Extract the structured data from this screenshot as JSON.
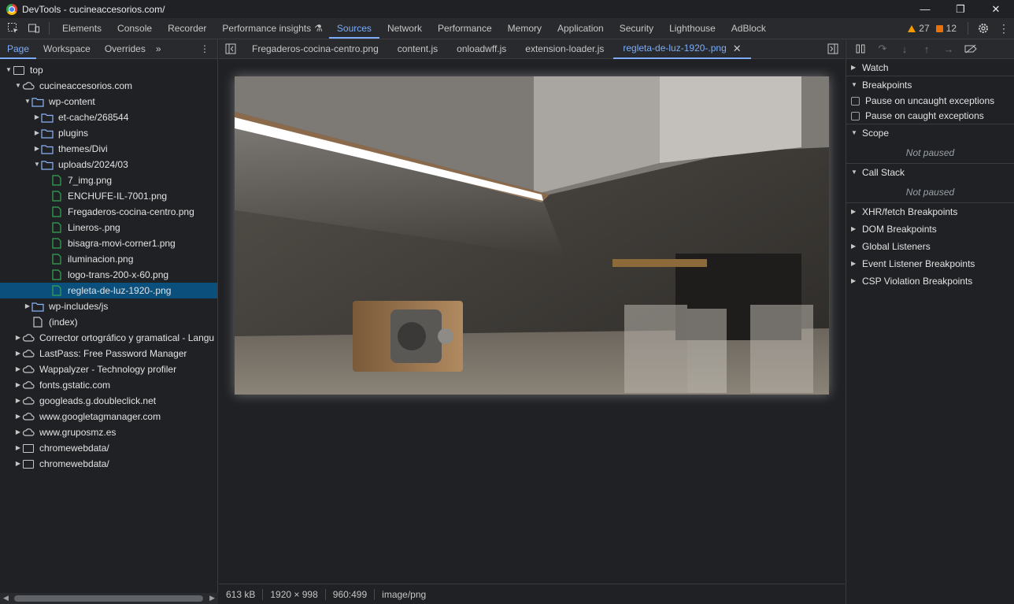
{
  "window": {
    "title": "DevTools - cucineaccesorios.com/",
    "controls": {
      "minimize": "—",
      "restore": "❐",
      "close": "✕"
    }
  },
  "toolbar": {
    "tabs": [
      "Elements",
      "Console",
      "Recorder",
      "Performance insights",
      "Sources",
      "Network",
      "Performance",
      "Memory",
      "Application",
      "Security",
      "Lighthouse",
      "AdBlock"
    ],
    "active_tab": "Sources",
    "warnings_count": "27",
    "errors_count": "12"
  },
  "navigator": {
    "tabs": [
      "Page",
      "Workspace",
      "Overrides"
    ],
    "more": "»",
    "tree": [
      {
        "label": "top",
        "depth": 0,
        "icon": "frame-icon",
        "expanded": true
      },
      {
        "label": "cucineaccesorios.com",
        "depth": 1,
        "icon": "cloud-icon",
        "expanded": true
      },
      {
        "label": "wp-content",
        "depth": 2,
        "icon": "folder-icon",
        "expanded": true
      },
      {
        "label": "et-cache/268544",
        "depth": 3,
        "icon": "folder-icon",
        "expanded": false
      },
      {
        "label": "plugins",
        "depth": 3,
        "icon": "folder-icon",
        "expanded": false
      },
      {
        "label": "themes/Divi",
        "depth": 3,
        "icon": "folder-icon",
        "expanded": false
      },
      {
        "label": "uploads/2024/03",
        "depth": 3,
        "icon": "folder-icon",
        "expanded": true
      },
      {
        "label": "7_img.png",
        "depth": 4,
        "icon": "image-file-icon"
      },
      {
        "label": "ENCHUFE-IL-7001.png",
        "depth": 4,
        "icon": "image-file-icon"
      },
      {
        "label": "Fregaderos-cocina-centro.png",
        "depth": 4,
        "icon": "image-file-icon"
      },
      {
        "label": "Lineros-.png",
        "depth": 4,
        "icon": "image-file-icon"
      },
      {
        "label": "bisagra-movi-corner1.png",
        "depth": 4,
        "icon": "image-file-icon"
      },
      {
        "label": "iluminacion.png",
        "depth": 4,
        "icon": "image-file-icon"
      },
      {
        "label": "logo-trans-200-x-60.png",
        "depth": 4,
        "icon": "image-file-icon"
      },
      {
        "label": "regleta-de-luz-1920-.png",
        "depth": 4,
        "icon": "image-file-icon",
        "selected": true
      },
      {
        "label": "wp-includes/js",
        "depth": 2,
        "icon": "folder-icon",
        "expanded": false
      },
      {
        "label": "(index)",
        "depth": 2,
        "icon": "document-icon"
      },
      {
        "label": "Corrector ortográfico y gramatical - Langu",
        "depth": 1,
        "icon": "cloud-icon",
        "expanded": false
      },
      {
        "label": "LastPass: Free Password Manager",
        "depth": 1,
        "icon": "cloud-icon",
        "expanded": false
      },
      {
        "label": "Wappalyzer - Technology profiler",
        "depth": 1,
        "icon": "cloud-icon",
        "expanded": false
      },
      {
        "label": "fonts.gstatic.com",
        "depth": 1,
        "icon": "cloud-icon",
        "expanded": false
      },
      {
        "label": "googleads.g.doubleclick.net",
        "depth": 1,
        "icon": "cloud-icon",
        "expanded": false
      },
      {
        "label": "www.googletagmanager.com",
        "depth": 1,
        "icon": "cloud-icon",
        "expanded": false
      },
      {
        "label": "www.gruposmz.es",
        "depth": 1,
        "icon": "cloud-icon",
        "expanded": false
      },
      {
        "label": "chromewebdata/",
        "depth": 1,
        "icon": "frame-icon",
        "expanded": false
      },
      {
        "label": "chromewebdata/",
        "depth": 1,
        "icon": "frame-icon",
        "expanded": false
      }
    ]
  },
  "editor": {
    "tabs": [
      {
        "label": "Fregaderos-cocina-centro.png"
      },
      {
        "label": "content.js"
      },
      {
        "label": "onloadwff.js"
      },
      {
        "label": "extension-loader.js"
      },
      {
        "label": "regleta-de-luz-1920-.png",
        "active": true
      }
    ],
    "close_glyph": "✕",
    "status": {
      "size": "613 kB",
      "dimensions": "1920 × 998",
      "cursor": "960:499",
      "mime": "image/png"
    }
  },
  "debugger": {
    "sections": {
      "watch": "Watch",
      "breakpoints": "Breakpoints",
      "pause_uncaught": "Pause on uncaught exceptions",
      "pause_caught": "Pause on caught exceptions",
      "scope": "Scope",
      "scope_status": "Not paused",
      "call_stack": "Call Stack",
      "call_stack_status": "Not paused",
      "xhr": "XHR/fetch Breakpoints",
      "dom": "DOM Breakpoints",
      "global": "Global Listeners",
      "event": "Event Listener Breakpoints",
      "csp": "CSP Violation Breakpoints"
    }
  },
  "colors": {
    "accent": "#7cacf8",
    "selection": "#0b4f7c",
    "file_icon": "#34a853",
    "folder_icon": "#8ab4f8"
  }
}
